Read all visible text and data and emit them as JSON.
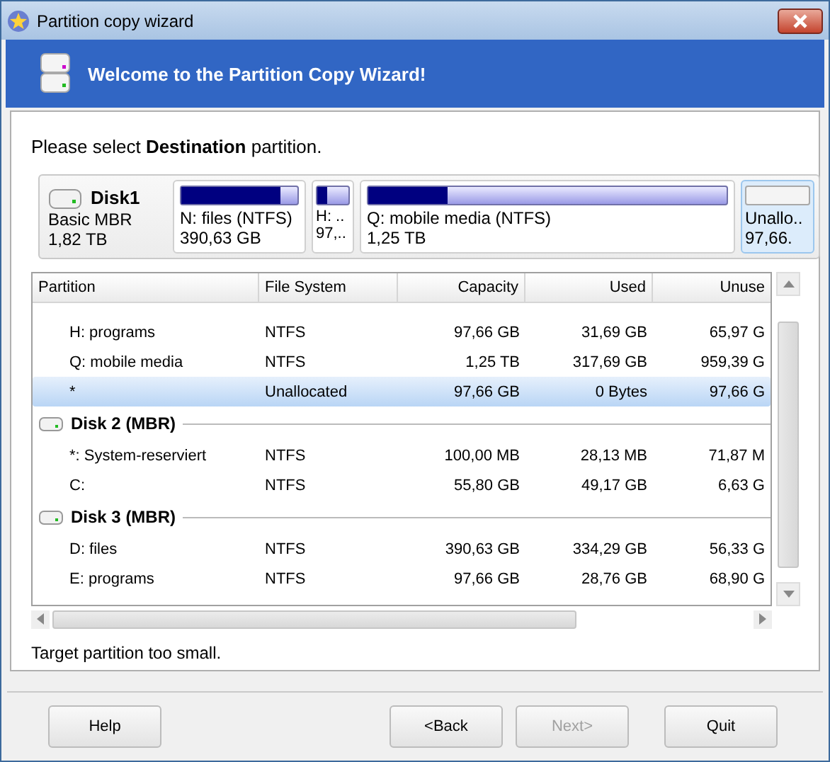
{
  "window": {
    "title": "Partition copy wizard"
  },
  "header": {
    "title": "Welcome to the Partition Copy Wizard!"
  },
  "instruction": "Please select **Destination** partition.",
  "disk_map": {
    "name": "Disk1",
    "type": "Basic MBR",
    "size": "1,82 TB",
    "partitions": [
      {
        "label": "N: files (NTFS)",
        "size": "390,63 GB",
        "level": 0.85,
        "selected": false
      },
      {
        "label": "H: ..",
        "size": "97,..",
        "level": 0.3,
        "selected": false
      },
      {
        "label": "Q: mobile media (NTFS)",
        "size": "1,25 TB",
        "level": 0.22,
        "selected": false
      },
      {
        "label": "Unallo..",
        "size": "97,66.",
        "selected": true
      }
    ]
  },
  "table": {
    "columns": [
      "Partition",
      "File System",
      "Capacity",
      "Used",
      "Unuse"
    ],
    "rows": [
      {
        "kind": "partition",
        "selected": false,
        "cells": [
          "H: programs",
          "NTFS",
          "97,66 GB",
          "31,69 GB",
          "65,97 G"
        ]
      },
      {
        "kind": "partition",
        "selected": false,
        "cells": [
          "Q: mobile media",
          "NTFS",
          "1,25 TB",
          "317,69 GB",
          "959,39 G"
        ]
      },
      {
        "kind": "partition",
        "selected": true,
        "cells": [
          "*",
          "Unallocated",
          "97,66 GB",
          "0 Bytes",
          "97,66 G"
        ]
      },
      {
        "kind": "disk",
        "title": "Disk 2 (MBR)"
      },
      {
        "kind": "partition",
        "selected": false,
        "cells": [
          "*: System-reserviert",
          "NTFS",
          "100,00 MB",
          "28,13 MB",
          "71,87 M"
        ]
      },
      {
        "kind": "partition",
        "selected": false,
        "cells": [
          "C:",
          "NTFS",
          "55,80 GB",
          "49,17 GB",
          "6,63 G"
        ]
      },
      {
        "kind": "disk",
        "title": "Disk 3 (MBR)"
      },
      {
        "kind": "partition",
        "selected": false,
        "cells": [
          "D: files",
          "NTFS",
          "390,63 GB",
          "334,29 GB",
          "56,33 G"
        ]
      },
      {
        "kind": "partition",
        "selected": false,
        "cells": [
          "E: programs",
          "NTFS",
          "97,66 GB",
          "28,76 GB",
          "68,90 G"
        ]
      }
    ]
  },
  "status": "Target partition too small.",
  "buttons": [
    {
      "label": "Help",
      "disabled": false
    },
    {
      "label": "<Back",
      "disabled": false
    },
    {
      "label": "Next>",
      "disabled": true
    },
    {
      "label": "Quit",
      "disabled": false
    }
  ]
}
